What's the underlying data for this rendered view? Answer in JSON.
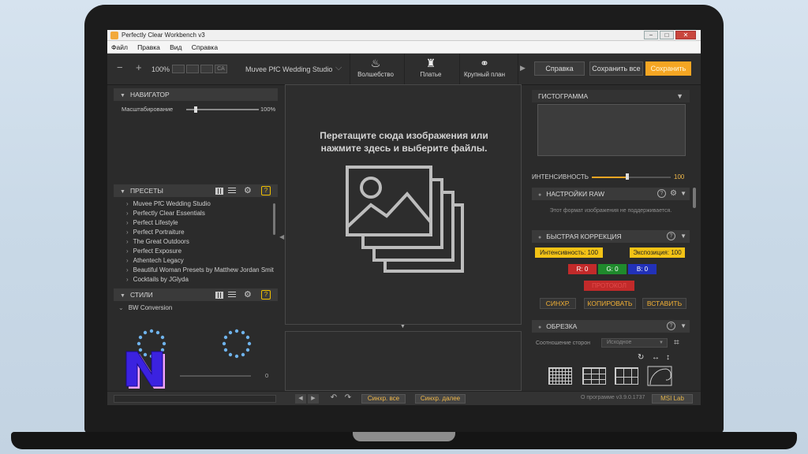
{
  "window": {
    "title": "Perfectly Clear Workbench v3",
    "controls": [
      "−",
      "□",
      "✕"
    ]
  },
  "menu": [
    "Файл",
    "Правка",
    "Вид",
    "Справка"
  ],
  "toolbar": {
    "minus": "−",
    "plus": "+",
    "zoom": "100%",
    "ca_label": "CA",
    "preset_select": "Muvee PfC Wedding Studio",
    "tools": [
      {
        "label": "Волшебство",
        "icon": "magic-icon",
        "glyph": "♨"
      },
      {
        "label": "Платье",
        "icon": "dress-icon",
        "glyph": "♜"
      },
      {
        "label": "Крупный план",
        "icon": "rings-icon",
        "glyph": "⚭"
      }
    ],
    "help_label": "Справка",
    "save_all_label": "Сохранить все",
    "save_label": "Сохранить"
  },
  "navigator": {
    "title": "НАВИГАТОР",
    "scale_label": "Масштабирование",
    "scale_value": "100%",
    "scale_fraction": 0.02
  },
  "presets": {
    "title": "ПРЕСЕТЫ",
    "items": [
      "Muvee PfC Wedding Studio",
      "Perfectly Clear Essentials",
      "Perfect Lifestyle",
      "Perfect Portraiture",
      "The Great Outdoors",
      "Perfect Exposure",
      "Athentech Legacy",
      "Beautiful Woman Presets by Matthew Jordan Smit",
      "Cocktails by JGlyda"
    ]
  },
  "styles": {
    "title": "СТИЛИ",
    "item": "BW Conversion",
    "slider_value": "0"
  },
  "center": {
    "drop_line1": "Перетащите сюда изображения или",
    "drop_line2": "нажмите здесь и выберите файлы."
  },
  "histogram": {
    "title": "ГИСТОГРАММА",
    "intensity_label": "ИНТЕНСИВНОСТЬ",
    "intensity_value": "100",
    "intensity_fraction": 0.45
  },
  "raw": {
    "title": "НАСТРОЙКИ RAW",
    "message": "Этот формат изображения не поддерживается."
  },
  "quick": {
    "title": "БЫСТРАЯ КОРРЕКЦИЯ",
    "intensity": "Интенсивность: 100",
    "exposure": "Экспозиция: 100",
    "r": "R: 0",
    "g": "G: 0",
    "b": "B: 0",
    "reset": "ПРОТОКОЛ",
    "sync": "СИНХР.",
    "copy": "КОПИРОВАТЬ",
    "paste": "ВСТАВИТЬ"
  },
  "crop": {
    "title": "ОБРЕЗКА",
    "ratio_label": "Соотношение сторон",
    "ratio_value": "Исходное"
  },
  "status": {
    "sync_all": "Синхр. все",
    "sync_next": "Синхр. далее",
    "about": "О программе v3.9.0.1737",
    "brand": "MSI Lab"
  },
  "colors": {
    "accent": "#f5a623",
    "red_chip": "#c22a2a",
    "green_chip": "#1f8a2c",
    "blue_chip": "#2231b8",
    "yellow_chip": "#f3c316",
    "logo": "#3b22e0"
  }
}
